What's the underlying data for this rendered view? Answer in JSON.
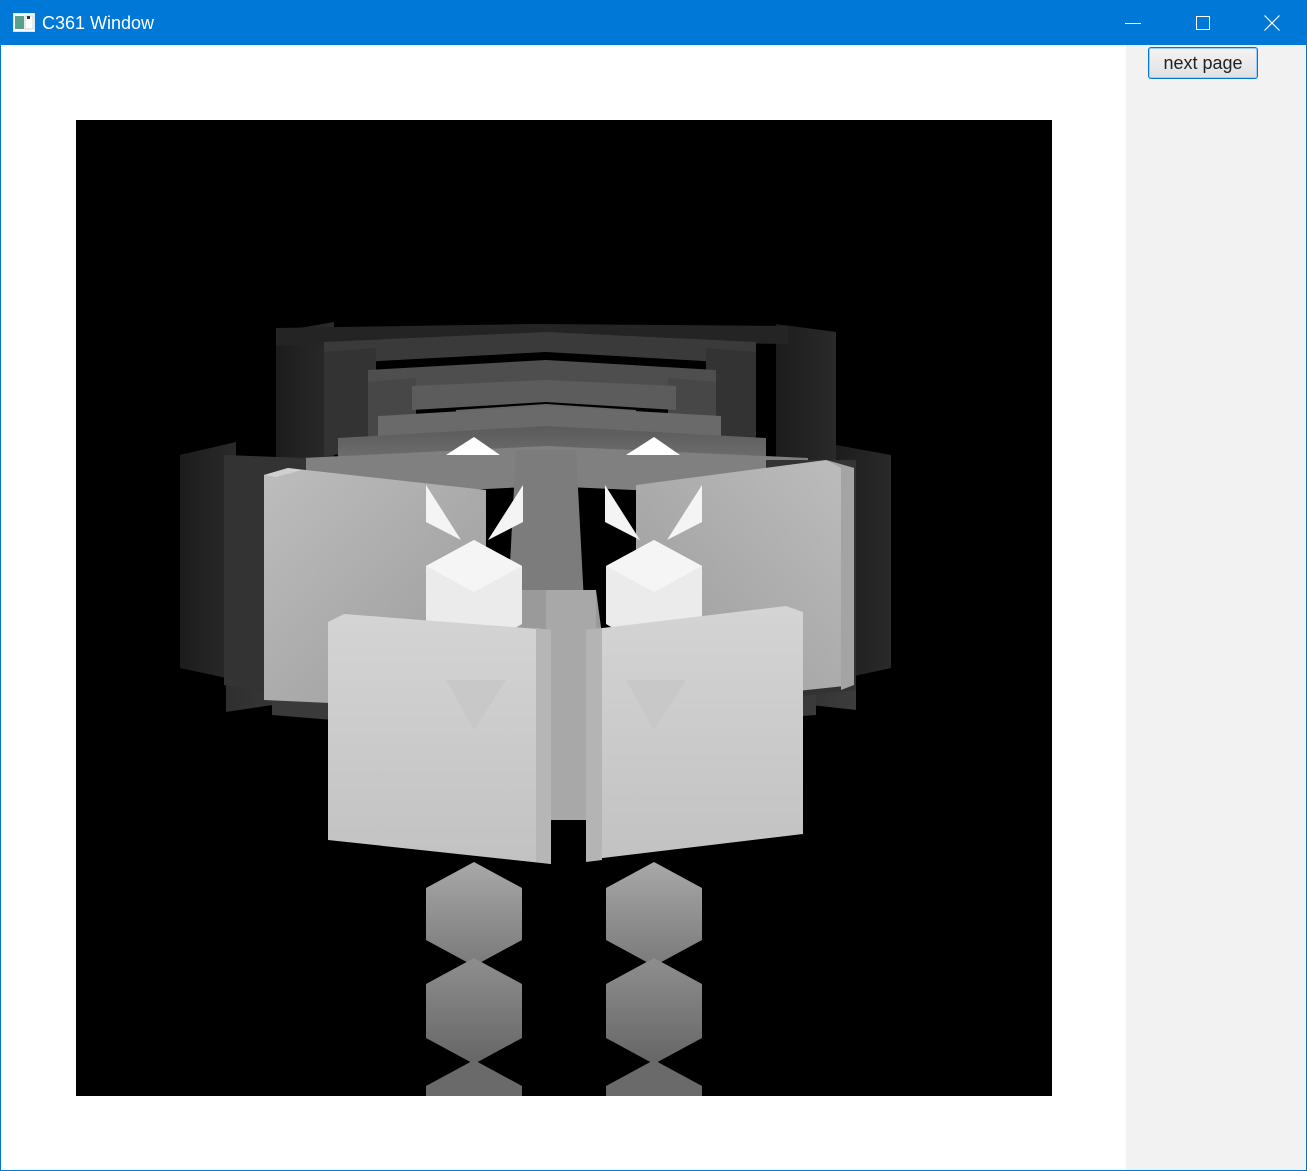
{
  "window": {
    "title": "C361 Window",
    "title_bar_color": "#0078d7",
    "controls": {
      "minimize_icon": "minimize-icon",
      "maximize_icon": "maximize-icon",
      "close_icon": "close-icon"
    }
  },
  "side_panel": {
    "next_button_label": "next page",
    "background": "#f2f2f2"
  },
  "viewport": {
    "description_icon": "depth-render",
    "background": "#000000"
  }
}
